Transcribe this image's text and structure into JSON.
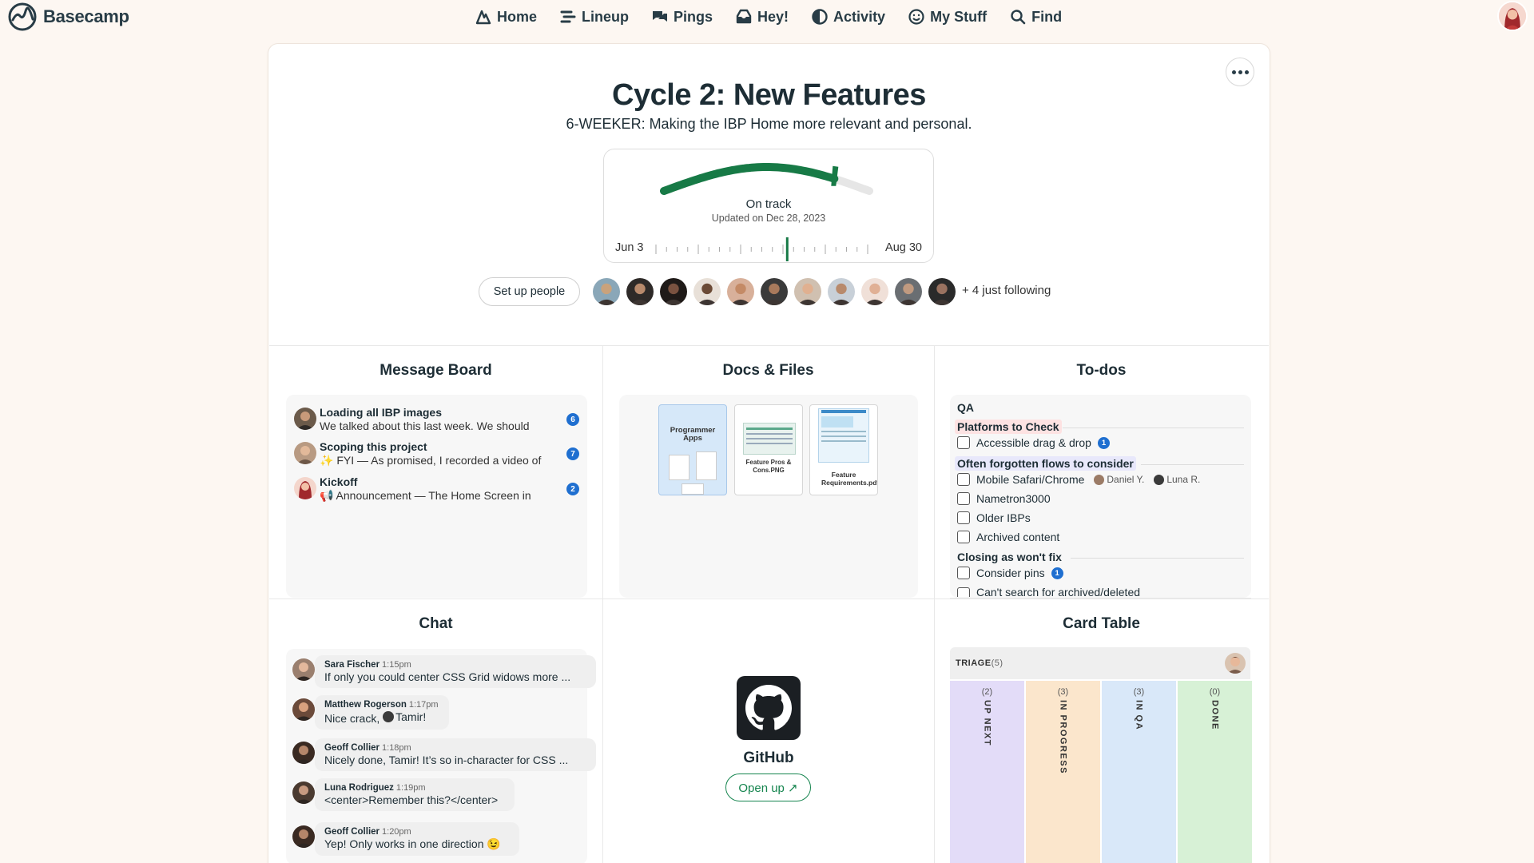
{
  "app": {
    "name": "Basecamp"
  },
  "nav": [
    {
      "label": "Home",
      "icon": "home-icon"
    },
    {
      "label": "Lineup",
      "icon": "lineup-icon"
    },
    {
      "label": "Pings",
      "icon": "pings-icon"
    },
    {
      "label": "Hey!",
      "icon": "hey-icon"
    },
    {
      "label": "Activity",
      "icon": "activity-icon"
    },
    {
      "label": "My Stuff",
      "icon": "my-stuff-icon"
    },
    {
      "label": "Find",
      "icon": "search-icon"
    }
  ],
  "project": {
    "title": "Cycle 2: New Features",
    "description": "6-WEEKER: Making the IBP Home more relevant and personal."
  },
  "hill": {
    "status": "On track",
    "updated": "Updated on Dec 28, 2023",
    "start": "Jun 3",
    "end": "Aug 30",
    "progress_fraction": 0.83,
    "timeline_fraction": 0.62,
    "color": "#177a46"
  },
  "people": {
    "setup_label": "Set up people",
    "avatar_count": 11,
    "following_label": "+ 4 just following"
  },
  "tools": {
    "message_board": "Message Board",
    "docs": "Docs & Files",
    "todos": "To-dos",
    "chat": "Chat",
    "card_table": "Card Table"
  },
  "messages": [
    {
      "title": "Loading all IBP images",
      "excerpt": "We talked about this last week. We should",
      "count": "6"
    },
    {
      "title": "Scoping this project",
      "excerpt": "✨ FYI — As promised, I recorded a video of",
      "count": "7"
    },
    {
      "title": "Kickoff",
      "excerpt": "📢 Announcement — The Home Screen in",
      "count": "2"
    }
  ],
  "docs": [
    {
      "label": "Programmer Apps",
      "kind": "folder"
    },
    {
      "label": "Feature Pros & Cons.PNG",
      "kind": "image"
    },
    {
      "label": "Feature Requirements.pdf",
      "kind": "pdf"
    }
  ],
  "todos": {
    "list": "QA",
    "groups": [
      {
        "name": "Platforms to Check",
        "highlight": "#fde2e2",
        "items": [
          {
            "text": "Accessible drag & drop",
            "badge": "1"
          }
        ]
      },
      {
        "name": "Often forgotten flows to consider",
        "highlight": "#e8e8fb",
        "items": [
          {
            "text": "Mobile Safari/Chrome",
            "assignees": [
              "Daniel Y.",
              "Luna R."
            ]
          },
          {
            "text": "Nametron3000"
          },
          {
            "text": "Older IBPs"
          },
          {
            "text": "Archived content"
          }
        ]
      },
      {
        "name": "Closing as won't fix",
        "highlight": "",
        "items": [
          {
            "text": "Consider pins",
            "badge": "1"
          },
          {
            "text": "Can't search for archived/deleted"
          }
        ]
      }
    ]
  },
  "chat": [
    {
      "name": "Sara Fischer",
      "time": "1:15pm",
      "text": "If only you could center CSS Grid widows more ..."
    },
    {
      "name": "Matthew Rogerson",
      "time": "1:17pm",
      "text": "Nice crack, ",
      "mention": "Tamir!"
    },
    {
      "name": "Geoff Collier",
      "time": "1:18pm",
      "text": "Nicely done, Tamir! It’s so in-character for CSS ..."
    },
    {
      "name": "Luna Rodriguez",
      "time": "1:19pm",
      "text": "<center>Remember this?</center>"
    },
    {
      "name": "Geoff Collier",
      "time": "1:20pm",
      "text": "Yep! Only works in one direction 😉"
    }
  ],
  "github": {
    "name": "GitHub",
    "button": "Open up ↗"
  },
  "card_table": {
    "triage_label": "TRIAGE",
    "triage_count": "(5)",
    "columns": [
      {
        "count": "(2)",
        "name": "UP NEXT",
        "color": "#e3dcf8"
      },
      {
        "count": "(3)",
        "name": "IN PROGRESS",
        "color": "#fbe6cc"
      },
      {
        "count": "(3)",
        "name": "IN QA",
        "color": "#d9e8f9"
      },
      {
        "count": "(0)",
        "name": "DONE",
        "color": "#d7f1d6"
      }
    ]
  }
}
